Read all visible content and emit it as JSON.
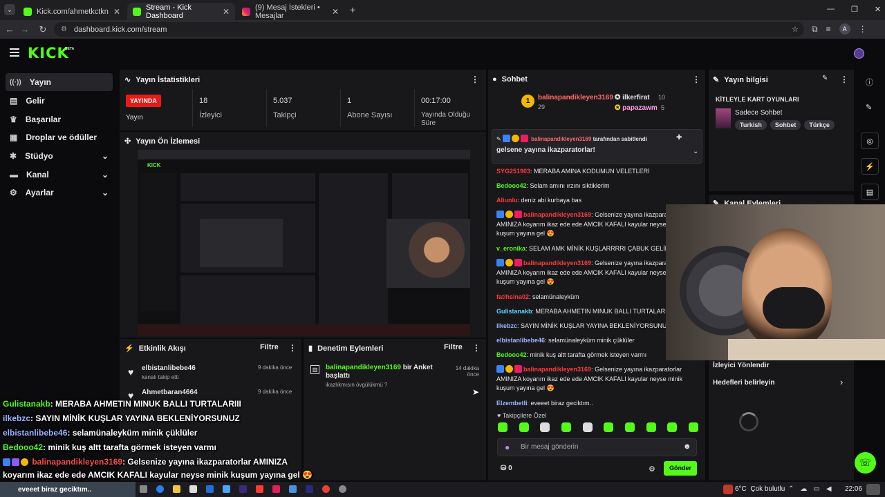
{
  "browser": {
    "tabs": [
      {
        "label": "Kick.com/ahmetkctkn",
        "active": false
      },
      {
        "label": "Stream - Kick Dashboard",
        "active": true
      },
      {
        "label": "(9) Mesaj İstekleri • Mesajlar",
        "active": false
      }
    ],
    "url": "dashboard.kick.com/stream",
    "profile_initial": "A"
  },
  "brand": {
    "logo": "KICK",
    "beta": "BETA",
    "accent": "#53fc18"
  },
  "sidebar": {
    "items": [
      {
        "label": "Yayın",
        "icon": "broadcast-icon",
        "active": true
      },
      {
        "label": "Gelir",
        "icon": "revenue-icon"
      },
      {
        "label": "Başarılar",
        "icon": "trophy-icon"
      },
      {
        "label": "Droplar ve ödüller",
        "icon": "gift-icon"
      },
      {
        "label": "Stüdyo",
        "icon": "studio-icon",
        "chevron": true
      },
      {
        "label": "Kanal",
        "icon": "channel-icon",
        "chevron": true
      },
      {
        "label": "Ayarlar",
        "icon": "gear-icon",
        "chevron": true
      }
    ]
  },
  "stats": {
    "title": "Yayın İstatistikleri",
    "live_badge": "YAYINDA",
    "items": [
      {
        "value": "",
        "label": "Yayın"
      },
      {
        "value": "18",
        "label": "İzleyici"
      },
      {
        "value": "5.037",
        "label": "Takipçi"
      },
      {
        "value": "1",
        "label": "Abone Sayısı"
      },
      {
        "value": "00:17:00",
        "label": "Yayında Olduğu Süre"
      }
    ]
  },
  "preview": {
    "title": "Yayın Ön İzlemesi"
  },
  "activity": {
    "title": "Etkinlik Akışı",
    "filter": "Filtre",
    "items": [
      {
        "user": "elbistanlibebe46",
        "time": "9 dakika önce",
        "desc": "kanalı takip etti"
      },
      {
        "user": "Ahmetbaran4664",
        "time": "9 dakika önce",
        "desc": ""
      }
    ]
  },
  "moderation": {
    "title": "Denetim Eylemleri",
    "filter": "Filtre",
    "items": [
      {
        "user": "balinapandikleyen3169",
        "action": "bir Anket başlattı",
        "sub": "ikazlıkmısın övgülükmü ?",
        "time": "14 dakika önce"
      }
    ]
  },
  "chat": {
    "title": "Sohbet",
    "leaders": [
      {
        "rank": "1",
        "name": "balinapandikleyen3169",
        "count": "29"
      },
      {
        "name": "ilkerfirat",
        "count": "10"
      },
      {
        "name": "papazawm",
        "count": "5"
      }
    ],
    "pinned_by_user": "balinapandikleyen3169",
    "pinned_by": "tarafından sabitlendi",
    "pinned_msg": "gelsene yayına ikazparatorlar!",
    "messages": [
      {
        "user": "SYG251903",
        "color": "u-red",
        "text": "MERABA AMINA KODUMUN VELETLERİ"
      },
      {
        "user": "Bedooo42",
        "color": "u-green",
        "text": "Selam amını ırzını siktiklerim"
      },
      {
        "user": "Aliunlu",
        "color": "u-red",
        "text": "deniz abi kurbaya bas"
      },
      {
        "user": "balinapandikleyen3169",
        "color": "u-red",
        "badges": true,
        "text": "Gelsenize yayına ikazparatorlar AMINIZA koyarım ikaz ede ede AMCIK KAFALI kayular neyse minik kuşum yayına gel 😍"
      },
      {
        "user": "v_eronika",
        "color": "u-green",
        "text": "SELAM AMK MİNİK KUŞLARRRRI ÇABUK GELİN"
      },
      {
        "user": "balinapandikleyen3169",
        "color": "u-red",
        "badges": true,
        "text": "Gelsenize yayına ikazparatorlar AMINIZA koyarım ikaz ede ede AMCIK KAFALI kayular neyse minik kuşum yayına gel 😍"
      },
      {
        "user": "fatihsina02",
        "color": "u-red",
        "text": "selamünaleyküm"
      },
      {
        "user": "Gulistanakb",
        "color": "u-cyan",
        "text": "MERABA AHMETIN MINUK BALLI TURTALARIII"
      },
      {
        "user": "ilkebzc",
        "color": "u-blue",
        "text": "SAYIN MİNİK KUŞLAR YAYINA BEKLENİYORSUNUZ"
      },
      {
        "user": "elbistanlibebe46",
        "color": "u-blue",
        "text": "selamünaleyküm minik çüklüler"
      },
      {
        "user": "Bedooo42",
        "color": "u-green",
        "text": "minik kuş altt tarafta görmek isteyen varmı"
      },
      {
        "user": "balinapandikleyen3169",
        "color": "u-red",
        "badges": true,
        "text": "Gelsenize yayına ikazparatorlar AMINIZA koyarım ikaz ede ede AMCIK KAFALI kayular neyse minik kuşum yayına gel 😍"
      },
      {
        "user": "Elzembetli",
        "color": "u-blue",
        "text": "eveeet biraz geciktım.."
      }
    ],
    "followers_only": "Takipçilere Özel",
    "input_placeholder": "Bir mesaj gönderin",
    "points": "0",
    "send": "Gönder"
  },
  "info": {
    "title": "Yayın bilgisi",
    "stream_title": "KİTLEYLE KART OYUNLARI",
    "category": "Sadece Sohbet",
    "tags": [
      "Turkish",
      "Sohbet",
      "Türkçe"
    ],
    "actions_title": "Kanal Eylemleri",
    "goal_label": "İzleyici Yönlendir",
    "goal_sub": "Hedefleri belirleyin"
  },
  "overlay": {
    "lines": [
      {
        "user": "Gulistanakb",
        "color": "#53fc18",
        "text": ": MERABA AHMETIN MINUK BALLI TURTALARIII"
      },
      {
        "user": "ilkebzc",
        "color": "#9bb4ff",
        "text": ": SAYIN MİNİK KUŞLAR YAYINA BEKLENİYORSUNUZ"
      },
      {
        "user": "elbistanlibebe46",
        "color": "#9bb4ff",
        "text": ": selamünaleyküm minik çüklüler"
      },
      {
        "user": "Bedooo42",
        "color": "#53fc18",
        "text": ": minik kuş altt tarafta görmek isteyen varmı"
      },
      {
        "user": "balinapandikleyen3169",
        "color": "#ff3b3b",
        "text": ": Gelsenize yayına ikazparatorlar AMINIZA"
      },
      {
        "user": "",
        "color": "#fff",
        "text": "koyarım ikaz ede ede AMCIK KAFALI kayular neyse minik kuşum yayına gel 😍"
      }
    ],
    "last": "eveeet biraz geciktım.."
  },
  "taskbar": {
    "weather": "6°C  Çok bulutlu",
    "time": "22:06"
  }
}
